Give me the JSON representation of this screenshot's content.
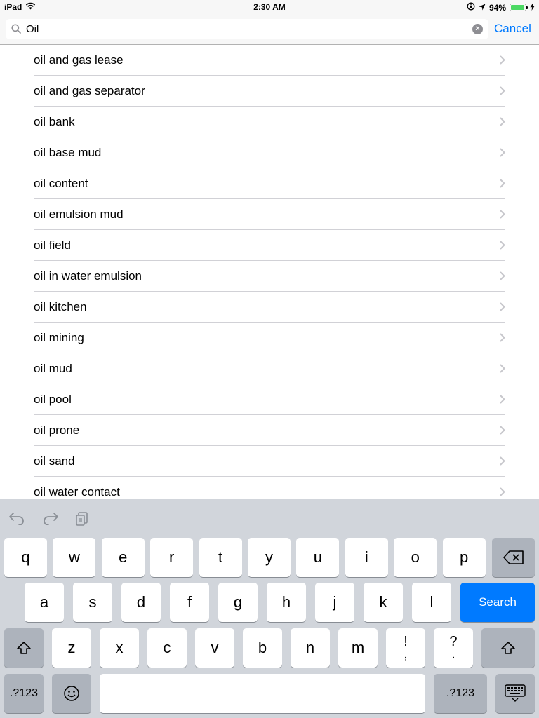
{
  "status_bar": {
    "device": "iPad",
    "time": "2:30 AM",
    "battery": "94%",
    "battery_level": 0.94,
    "icons": [
      "wifi-icon",
      "rotation-lock-icon",
      "location-icon",
      "battery-icon",
      "charging-icon"
    ]
  },
  "search": {
    "query": "Oil",
    "cancel_label": "Cancel",
    "icons": [
      "search-icon",
      "clear-icon"
    ]
  },
  "results": [
    "oil and gas lease",
    "oil and gas separator",
    "oil bank",
    "oil base mud",
    "oil content",
    "oil emulsion mud",
    "oil field",
    "oil in water emulsion",
    "oil kitchen",
    "oil mining",
    "oil mud",
    "oil pool",
    "oil prone",
    "oil sand",
    "oil water contact"
  ],
  "keyboard": {
    "toolbar_icons": [
      "undo-icon",
      "redo-icon",
      "paste-icon"
    ],
    "row1": [
      "q",
      "w",
      "e",
      "r",
      "t",
      "y",
      "u",
      "i",
      "o",
      "p"
    ],
    "row2": [
      "a",
      "s",
      "d",
      "f",
      "g",
      "h",
      "j",
      "k",
      "l"
    ],
    "row3": [
      "z",
      "x",
      "c",
      "v",
      "b",
      "n",
      "m"
    ],
    "punct_1_top": "!",
    "punct_1_bottom": ",",
    "punct_2_top": "?",
    "punct_2_bottom": ".",
    "search_label": "Search",
    "numbers_label": ".?123",
    "icons": [
      "backspace-icon",
      "shift-icon",
      "emoji-icon",
      "dismiss-keyboard-icon"
    ]
  },
  "colors": {
    "accent": "#007aff",
    "keyboard_bg": "#d1d5db",
    "battery_green": "#4cd964"
  }
}
